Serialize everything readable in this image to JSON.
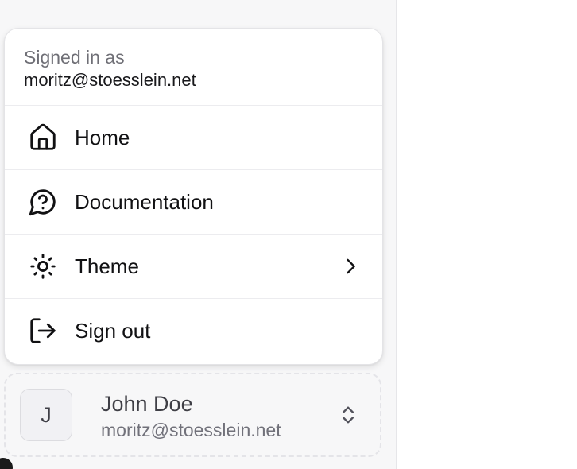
{
  "menu": {
    "signed_in_label": "Signed in as",
    "signed_in_email": "moritz@stoesslein.net",
    "items": [
      {
        "label": "Home",
        "icon": "home-icon"
      },
      {
        "label": "Documentation",
        "icon": "help-circle-icon"
      },
      {
        "label": "Theme",
        "icon": "sun-icon",
        "submenu_icon": "chevron-right-icon"
      },
      {
        "label": "Sign out",
        "icon": "log-out-icon"
      }
    ]
  },
  "user": {
    "avatar_initial": "J",
    "name": "John Doe",
    "email": "moritz@stoesslein.net",
    "toggle_icon": "chevrons-up-down-icon"
  },
  "colors": {
    "sidebar_bg": "#f7f7f8",
    "menu_bg": "#ffffff",
    "text_primary": "#111113",
    "text_muted": "#71717a"
  }
}
